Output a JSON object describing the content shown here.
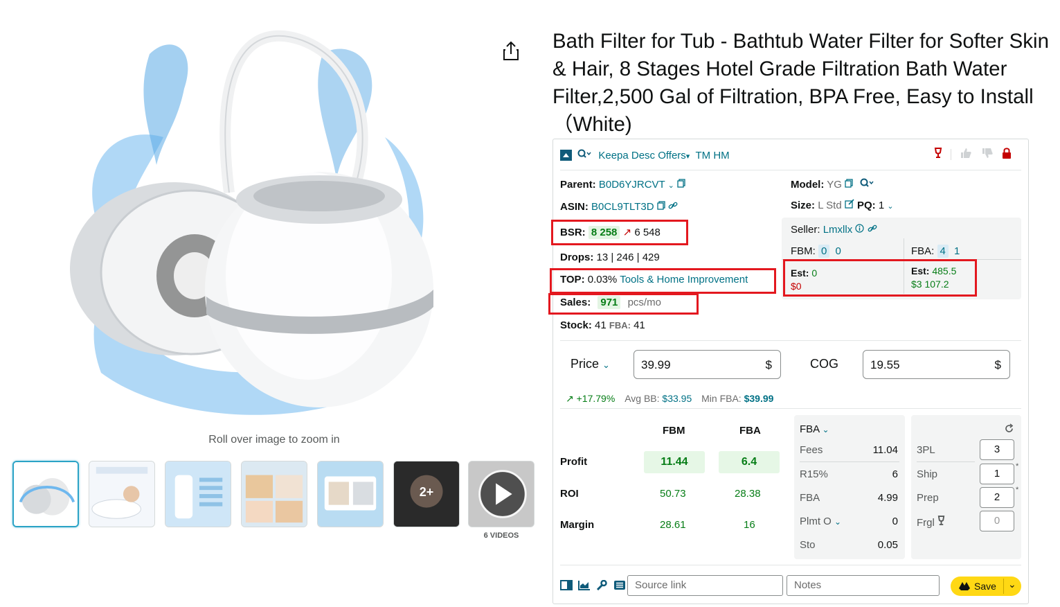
{
  "product": {
    "title": "Bath Filter for Tub - Bathtub Water Filter for Softer Skin & Hair, 8 Stages Hotel Grade Filtration Bath Water Filter,2,500 Gal of Filtration, BPA Free, Easy to Install（White)",
    "zoom_hint": "Roll over image to zoom in",
    "thumbs_more_label": "2+",
    "videos_label": "6 VIDEOS"
  },
  "keepa": {
    "toolbar_label": "Keepa Desc Offers",
    "toolbar_extra": "TM HM",
    "parent_label": "Parent:",
    "parent_value": "B0D6YJRCVT",
    "asin_label": "ASIN:",
    "asin_value": "B0CL9TLT3D",
    "bsr_label": "BSR:",
    "bsr_value": "8 258",
    "bsr_trend": "6 548",
    "drops_label": "Drops:",
    "drops_value": "13 | 246 | 429",
    "top_label": "TOP:",
    "top_value": "0.03%",
    "top_category": "Tools & Home Improvement",
    "sales_label": "Sales:",
    "sales_value": "971",
    "sales_unit": "pcs/mo",
    "stock_label": "Stock:",
    "stock_value": "41",
    "stock_fba_label": "FBA:",
    "stock_fba_value": "41",
    "model_label": "Model:",
    "model_value": "YG",
    "size_label": "Size:",
    "size_value": "L Std",
    "pq_label": "PQ:",
    "pq_value": "1",
    "seller_label": "Seller:",
    "seller_value": "Lmxllx",
    "fbm_label": "FBM:",
    "fbm_a": "0",
    "fbm_b": "0",
    "fba_label": "FBA:",
    "fba_a": "4",
    "fba_b": "1",
    "est_label": "Est:",
    "est_fbm_units": "0",
    "est_fbm_money": "$0",
    "est_fba_units": "485.5",
    "est_fba_money": "$3 107.2",
    "price_label": "Price",
    "price_value": "39.99",
    "currency": "$",
    "cog_label": "COG",
    "cog_value": "19.55",
    "price_change": "+17.79%",
    "avg_bb_label": "Avg BB:",
    "avg_bb_value": "$33.95",
    "min_fba_label": "Min FBA:",
    "min_fba_value": "$39.99",
    "col_fbm": "FBM",
    "col_fba": "FBA",
    "profit_label": "Profit",
    "profit_fbm": "11.44",
    "profit_fba": "6.4",
    "roi_label": "ROI",
    "roi_fbm": "50.73",
    "roi_fba": "28.38",
    "margin_label": "Margin",
    "margin_fbm": "28.61",
    "margin_fba": "16",
    "fees_selector": "FBA",
    "fees": [
      {
        "label": "Fees",
        "value": "11.04"
      },
      {
        "label": "R15%",
        "value": "6"
      },
      {
        "label": "FBA",
        "value": "4.99"
      },
      {
        "label": "Plmt O",
        "value": "0"
      },
      {
        "label": "Sto",
        "value": "0.05"
      }
    ],
    "extra": [
      {
        "label": "3PL",
        "value": "3"
      },
      {
        "label": "Ship",
        "value": "1"
      },
      {
        "label": "Prep",
        "value": "2"
      },
      {
        "label": "Frgl",
        "value": "0"
      }
    ],
    "source_placeholder": "Source link",
    "notes_placeholder": "Notes",
    "save_label": "Save"
  },
  "colors": {
    "highlight": "#e3181f",
    "link": "#007185",
    "green": "#067d16",
    "red": "#c40000",
    "save": "#ffd814"
  }
}
